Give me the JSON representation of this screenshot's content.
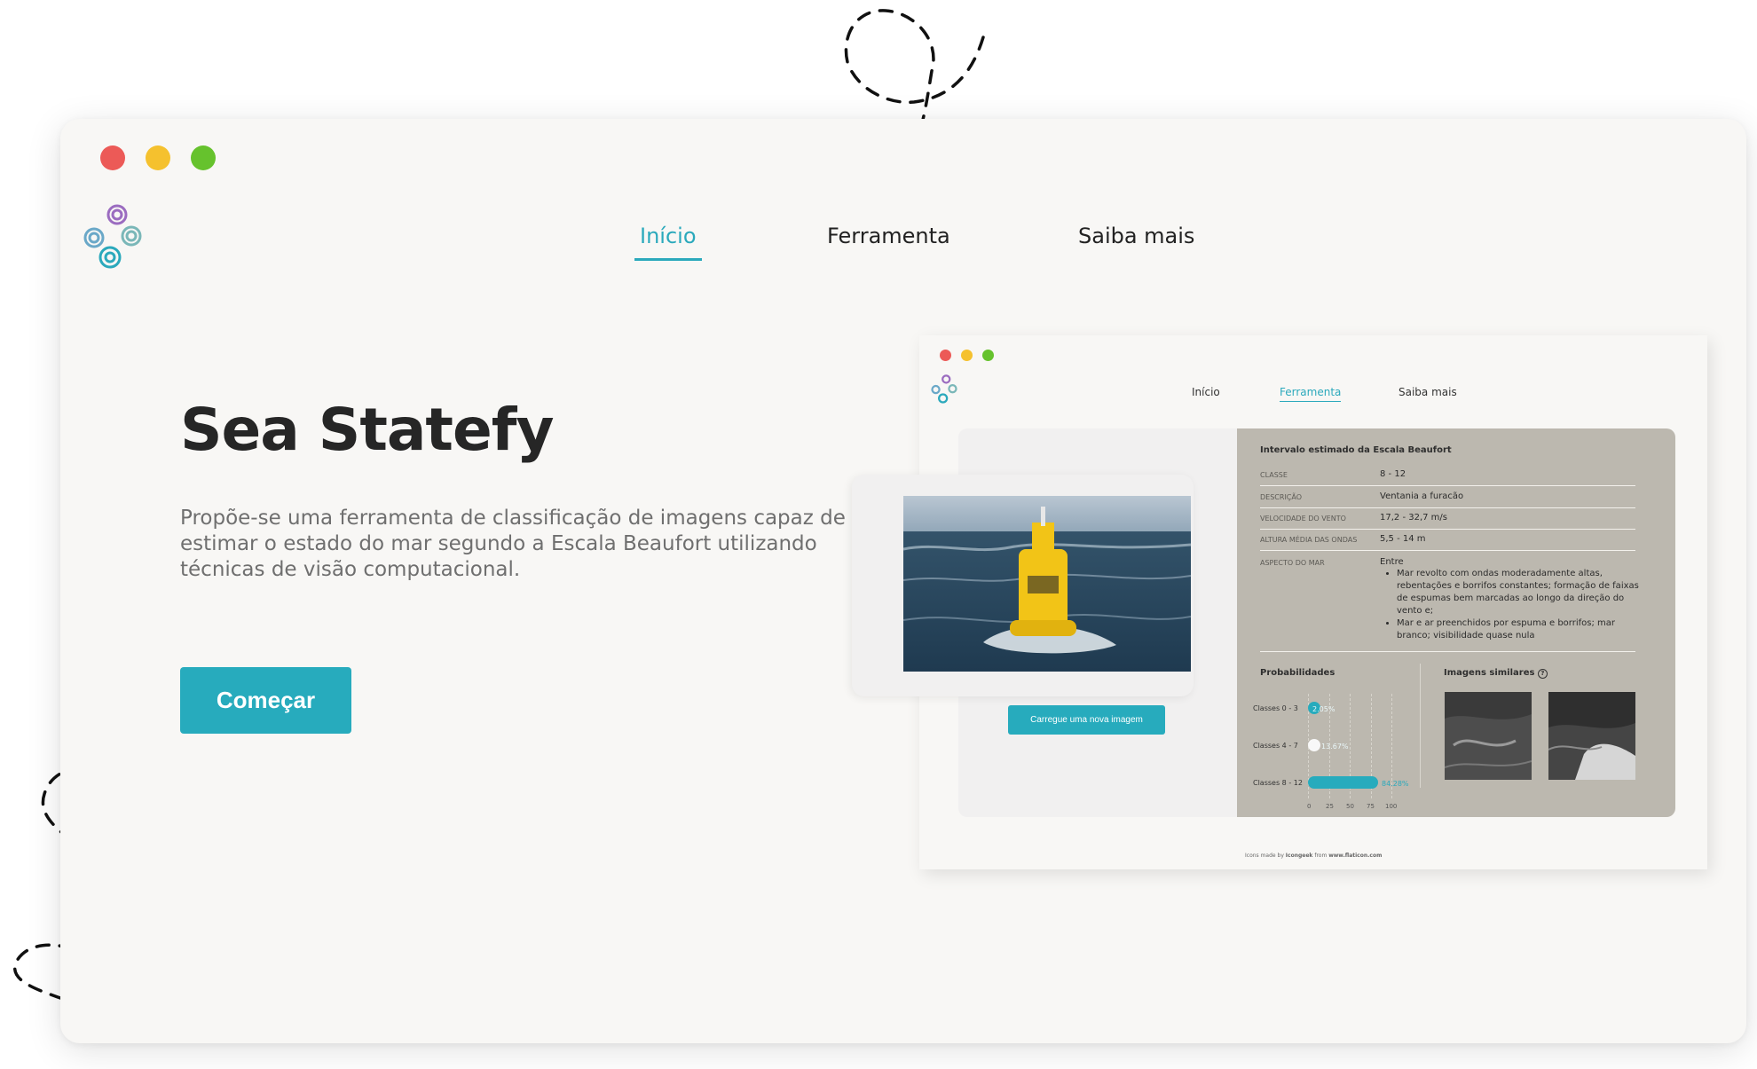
{
  "window_controls": {
    "close_color": "#ec5a57",
    "minimize_color": "#f5c12e",
    "maximize_color": "#66c22d"
  },
  "nav": {
    "inicio": "Início",
    "ferramenta": "Ferramenta",
    "saiba_mais": "Saiba mais",
    "active": "Início"
  },
  "hero": {
    "title": "Sea Statefy",
    "description": "Propõe-se uma ferramenta de classificação de imagens capaz de estimar o estado do mar segundo a Escala Beaufort utilizando técnicas de visão computacional.",
    "cta_label": "Começar"
  },
  "preview": {
    "nav": {
      "inicio": "Início",
      "ferramenta": "Ferramenta",
      "saiba_mais": "Saiba mais",
      "active": "Ferramenta"
    },
    "upload_label": "Carregue uma nova imagem",
    "result_title": "Intervalo estimado da Escala Beaufort",
    "rows": [
      {
        "label": "CLASSE",
        "value": "8 - 12"
      },
      {
        "label": "DESCRIÇÃO",
        "value": "Ventania a furacão"
      },
      {
        "label": "VELOCIDADE DO VENTO",
        "value": "17,2 - 32,7 m/s"
      },
      {
        "label": "ALTURA MÉDIA DAS ONDAS",
        "value": "5,5 - 14 m"
      }
    ],
    "aspect_label": "ASPECTO DO MAR",
    "aspect_intro": "Entre",
    "aspect_bullets": [
      "Mar revolto com ondas moderadamente altas, rebentações e borrifos constantes; formação de faixas de espumas bem marcadas ao longo da direção do vento e;",
      "Mar e ar preenchidos por espuma e borrifos; mar branco; visibilidade quase nula"
    ],
    "probabilities_title": "Probabilidades",
    "similar_title": "Imagens similares",
    "probabilities": [
      {
        "label": "Classes 0 - 3",
        "value": 2.05,
        "text": "2.05%"
      },
      {
        "label": "Classes 4 - 7",
        "value": 13.67,
        "text": "13.67%"
      },
      {
        "label": "Classes 8 - 12",
        "value": 84.28,
        "text": "84.28%"
      }
    ],
    "axis_ticks": [
      "0",
      "25",
      "50",
      "75",
      "100"
    ],
    "footer": {
      "prefix": "Icons made by",
      "author": "Icongeek",
      "middle": "from",
      "site": "www.flaticon.com"
    }
  }
}
